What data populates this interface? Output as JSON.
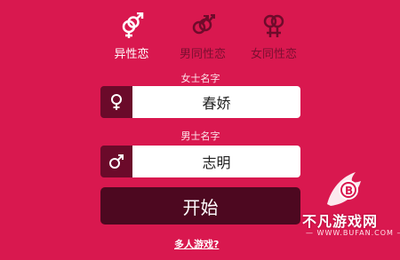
{
  "tabs": [
    {
      "label": "异性恋",
      "icon": "hetero-icon",
      "active": true
    },
    {
      "label": "男同性恋",
      "icon": "male-male-icon",
      "active": false
    },
    {
      "label": "女同性恋",
      "icon": "female-female-icon",
      "active": false
    }
  ],
  "female": {
    "label": "女士名字",
    "value": "春娇",
    "icon": "female-symbol-icon"
  },
  "male": {
    "label": "男士名字",
    "value": "志明",
    "icon": "male-symbol-icon"
  },
  "start_label": "开始",
  "multiplayer_label": "多人游戏?",
  "watermark": {
    "name": "不凡游戏网",
    "url": "— WWW.BUFAN.COM —"
  },
  "colors": {
    "background": "#d9184f",
    "icon_box": "#6b0a2a",
    "button": "#4d0820"
  }
}
